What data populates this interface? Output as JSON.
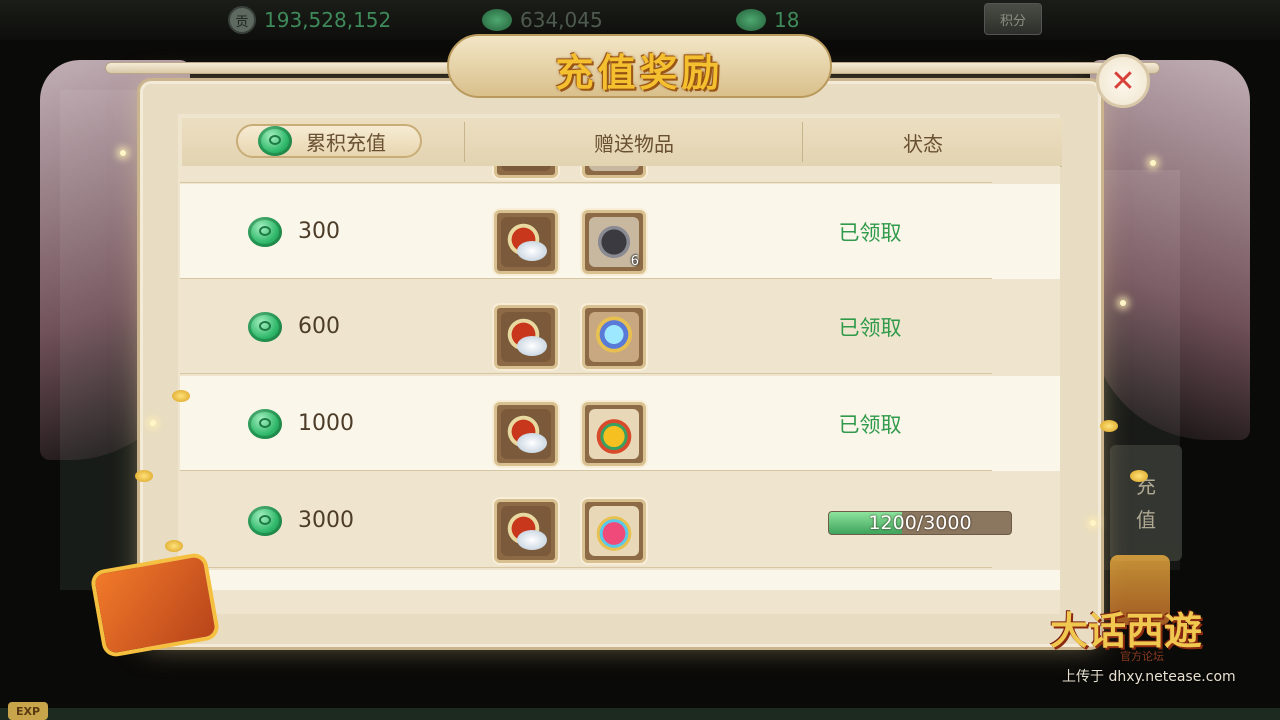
{
  "resources": {
    "contribution_icon_label": "贡",
    "silver": "193,528,152",
    "jade_coins": "634,045",
    "fairy_jade": "18",
    "points_button": "积分"
  },
  "dialog": {
    "title": "充值奖励",
    "close_symbol": "✕"
  },
  "table": {
    "headers": {
      "cumulative": "累积充值",
      "gifts": "赠送物品",
      "status": "状态"
    },
    "rows": [
      {
        "amount": "300",
        "items": [
          {
            "icon": "silver-money-bag-icon"
          },
          {
            "icon": "black-ore-icon",
            "count": "6"
          }
        ],
        "status": "已领取"
      },
      {
        "amount": "600",
        "items": [
          {
            "icon": "silver-money-bag-icon"
          },
          {
            "icon": "crystal-orb-icon"
          }
        ],
        "status": "已领取"
      },
      {
        "amount": "1000",
        "items": [
          {
            "icon": "silver-money-bag-icon"
          },
          {
            "icon": "gold-lucky-bag-icon"
          }
        ],
        "status": "已领取"
      },
      {
        "amount": "3000",
        "items": [
          {
            "icon": "silver-money-bag-icon"
          },
          {
            "icon": "pink-lucky-bag-icon"
          }
        ],
        "progress": {
          "current": 1200,
          "target": 3000,
          "label": "1200/3000"
        }
      }
    ]
  },
  "side_tab": {
    "label_1": "充",
    "label_2": "值"
  },
  "exp_label": "EXP",
  "branding": {
    "logo": "大话西遊",
    "logo_sub": "官方论坛",
    "watermark": "上传于 dhxy.netease.com"
  },
  "colors": {
    "claimed_green": "#2f9a4a",
    "title_gold": "#f5c030",
    "close_red": "#d8403a"
  }
}
